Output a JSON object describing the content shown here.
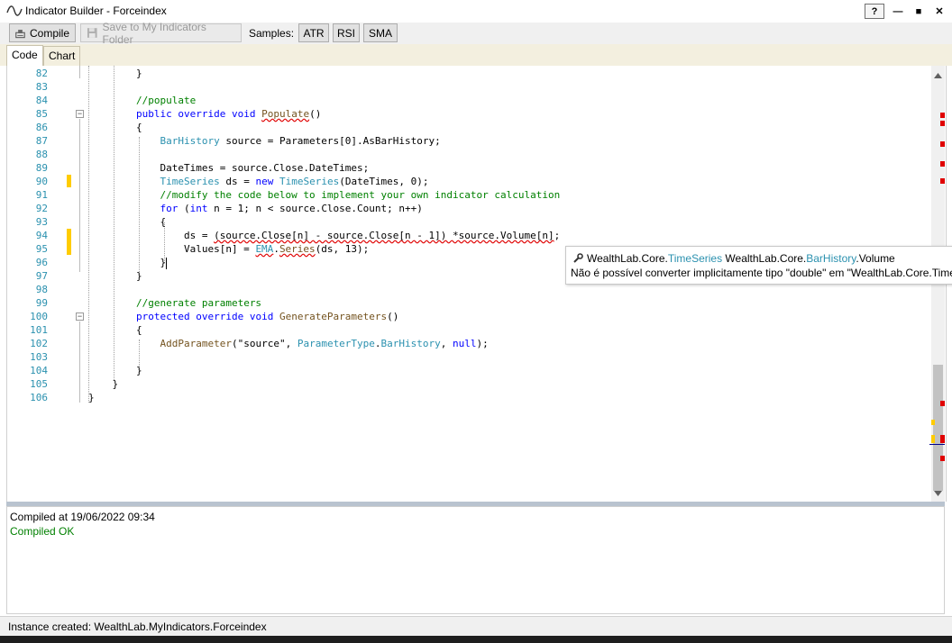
{
  "window": {
    "title": "Indicator Builder - Forceindex",
    "help_label": "?",
    "minimize_label": "—",
    "maximize_label": "■",
    "close_label": "✕"
  },
  "toolbar": {
    "compile_label": "Compile",
    "save_label": "Save to My Indicators Folder",
    "samples_label": "Samples:",
    "samples": [
      "ATR",
      "RSI",
      "SMA"
    ]
  },
  "tabs": [
    "Code",
    "Chart"
  ],
  "editor": {
    "lines": [
      {
        "n": "82",
        "text": "        }"
      },
      {
        "n": "83",
        "text": ""
      },
      {
        "n": "84",
        "text": "        //populate"
      },
      {
        "n": "85",
        "text": "        public override void Populate()"
      },
      {
        "n": "86",
        "text": "        {"
      },
      {
        "n": "87",
        "text": "            BarHistory source = Parameters[0].AsBarHistory;"
      },
      {
        "n": "88",
        "text": ""
      },
      {
        "n": "89",
        "text": "            DateTimes = source.Close.DateTimes;"
      },
      {
        "n": "90",
        "text": "            TimeSeries ds = new TimeSeries(DateTimes, 0);"
      },
      {
        "n": "91",
        "text": "            //modify the code below to implement your own indicator calculation"
      },
      {
        "n": "92",
        "text": "            for (int n = 1; n < source.Close.Count; n++)"
      },
      {
        "n": "93",
        "text": "            {"
      },
      {
        "n": "94",
        "text": "                ds = (source.Close[n] - source.Close[n - 1]) *source.Volume[n];"
      },
      {
        "n": "95",
        "text": "                Values[n] = EMA.Series(ds, 13);"
      },
      {
        "n": "96",
        "text": "            }"
      },
      {
        "n": "97",
        "text": "        }"
      },
      {
        "n": "98",
        "text": ""
      },
      {
        "n": "99",
        "text": "        //generate parameters"
      },
      {
        "n": "100",
        "text": "        protected override void GenerateParameters()"
      },
      {
        "n": "101",
        "text": "        {"
      },
      {
        "n": "102",
        "text": "            AddParameter(\"source\", ParameterType.BarHistory, null);"
      },
      {
        "n": "103",
        "text": ""
      },
      {
        "n": "104",
        "text": "        }"
      },
      {
        "n": "105",
        "text": "    }"
      },
      {
        "n": "106",
        "text": "}"
      }
    ]
  },
  "tooltip": {
    "line1_prefix": "WealthLab.Core.",
    "line1_type": "TimeSeries",
    "line1_mid": " WealthLab.Core.",
    "line1_type2": "BarHistory",
    "line1_suffix": ".Volume",
    "line2": "Não é possível converter implicitamente tipo \"double\" em \"WealthLab.Core.Time"
  },
  "output": {
    "line1": "Compiled at 19/06/2022 09:34",
    "line2": "Compiled OK"
  },
  "status": {
    "text": "Instance created: WealthLab.MyIndicators.Forceindex"
  },
  "colors": {
    "keyword": "#0000ff",
    "type": "#2b91af",
    "comment": "#008000",
    "success": "#008000",
    "error_marker": "#e00000",
    "change_marker": "#ffcc00"
  }
}
